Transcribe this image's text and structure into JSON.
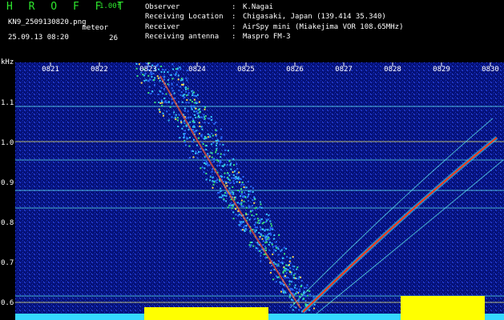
{
  "header": {
    "app_title": "H R O F F T",
    "version": "1.00f",
    "filename": "KN9_2509130820.png",
    "datetime": "25.09.13 08:20",
    "meteor_label": "meteor",
    "meteor_count": "26"
  },
  "info": [
    {
      "key": "Observer",
      "value": "K.Nagai"
    },
    {
      "key": "Receiving Location",
      "value": "Chigasaki, Japan (139.414 35.340)"
    },
    {
      "key": "Receiver",
      "value": "AirSpy mini (Miakejima VOR 108.65MHz)"
    },
    {
      "key": "Receiving antenna",
      "value": "Maspro FM-3"
    }
  ],
  "axis": {
    "y_unit": "kHz",
    "y_ticks": [
      "1.1",
      "1.0",
      "0.9",
      "0.8",
      "0.7",
      "0.6"
    ],
    "x_ticks": [
      "0821",
      "0822",
      "0823",
      "0824",
      "0825",
      "0826",
      "0827",
      "0828",
      "0829",
      "0830"
    ]
  },
  "colors": {
    "background": "#000000",
    "waterfall_bg": "#06127a",
    "title_green": "#2ee62e",
    "grid_yellow": "#d8d86a",
    "grid_cyan": "#5ad8e6",
    "signal": "#ff3a1a",
    "noise_yellow": "#ffff00"
  }
}
